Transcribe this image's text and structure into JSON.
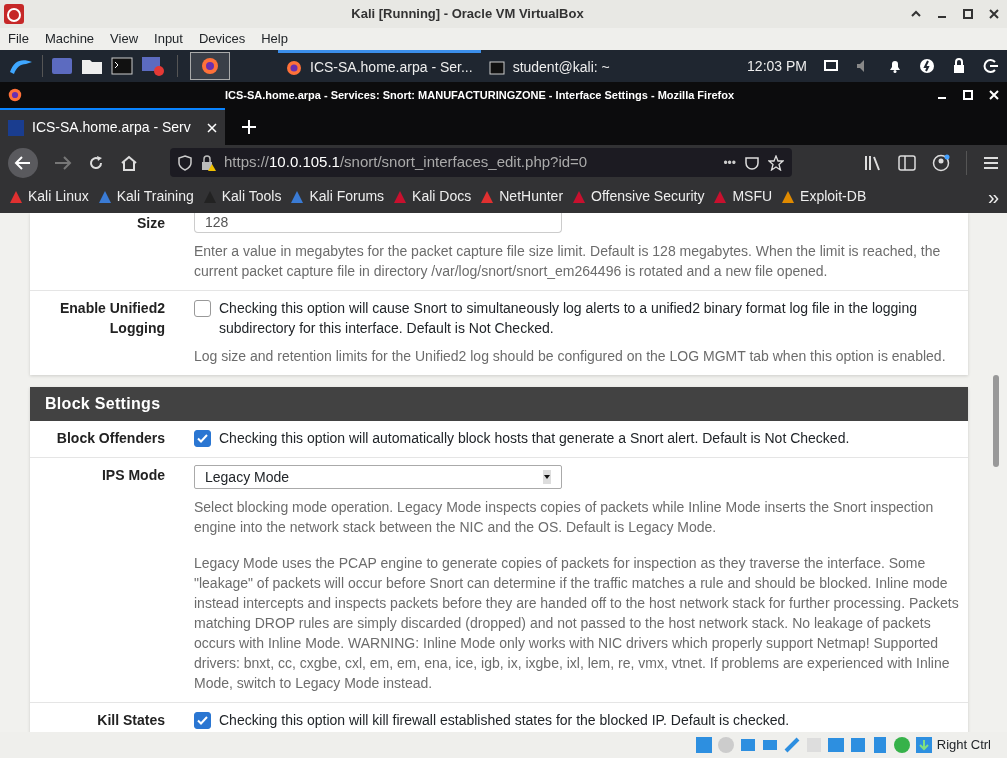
{
  "vbox": {
    "title": "Kali [Running] - Oracle VM VirtualBox",
    "menu": [
      "File",
      "Machine",
      "View",
      "Input",
      "Devices",
      "Help"
    ],
    "status_text": "Right Ctrl"
  },
  "taskbar": {
    "tasks": [
      {
        "label": "ICS-SA.home.arpa - Ser...",
        "kind": "firefox",
        "selected": true
      },
      {
        "label": "student@kali: ~",
        "kind": "terminal",
        "selected": false
      }
    ],
    "clock": "12:03 PM"
  },
  "firefox": {
    "title": "ICS-SA.home.arpa - Services: Snort: MANUFACTURINGZONE - Interface Settings - Mozilla Firefox",
    "tab": "ICS-SA.home.arpa - Serv",
    "url_prefix": "https://",
    "url_host": "10.0.105.1",
    "url_path": "/snort/snort_interfaces_edit.php?id=0",
    "more": "•••",
    "overflow": "»",
    "bookmarks": [
      {
        "label": "Kali Linux",
        "color": "#e03030"
      },
      {
        "label": "Kali Training",
        "color": "#3a7bd5"
      },
      {
        "label": "Kali Tools",
        "color": "#222222"
      },
      {
        "label": "Kali Forums",
        "color": "#3a7bd5"
      },
      {
        "label": "Kali Docs",
        "color": "#c8102e"
      },
      {
        "label": "NetHunter",
        "color": "#e03030"
      },
      {
        "label": "Offensive Security",
        "color": "#c8102e"
      },
      {
        "label": "MSFU",
        "color": "#c8102e"
      },
      {
        "label": "Exploit-DB",
        "color": "#e08a00"
      }
    ]
  },
  "page": {
    "top_rows": [
      {
        "kind": "input",
        "label": "Size",
        "value": "128",
        "help": "Enter a value in megabytes for the packet capture file size limit. Default is 128 megabytes. When the limit is reached, the current packet capture file in directory /var/log/snort/snort_em264496 is rotated and a new file opened."
      },
      {
        "kind": "checkbox",
        "label": "Enable Unified2 Logging",
        "checked": false,
        "text": "Checking this option will cause Snort to simultaneously log alerts to a unified2 binary format log file in the logging subdirectory for this interface. Default is Not Checked.",
        "help": "Log size and retention limits for the Unified2 log should be configured on the LOG MGMT tab when this option is enabled."
      }
    ],
    "section": "Block Settings",
    "rows": [
      {
        "kind": "checkbox",
        "label": "Block Offenders",
        "checked": true,
        "text": "Checking this option will automatically block hosts that generate a Snort alert. Default is Not Checked."
      },
      {
        "kind": "select",
        "label": "IPS Mode",
        "value": "Legacy Mode",
        "help": "Select blocking mode operation. Legacy Mode inspects copies of packets while Inline Mode inserts the Snort inspection engine into the network stack between the NIC and the OS. Default is Legacy Mode.",
        "help2": "Legacy Mode uses the PCAP engine to generate copies of packets for inspection as they traverse the interface. Some \"leakage\" of packets will occur before Snort can determine if the traffic matches a rule and should be blocked. Inline mode instead intercepts and inspects packets before they are handed off to the host network stack for further processing. Packets matching DROP rules are simply discarded (dropped) and not passed to the host network stack. No leakage of packets occurs with Inline Mode. WARNING: Inline Mode only works with NIC drivers which properly support Netmap! Supported drivers: bnxt, cc, cxgbe, cxl, em, em, ena, ice, igb, ix, ixgbe, ixl, lem, re, vmx, vtnet. If problems are experienced with Inline Mode, switch to Legacy Mode instead."
      },
      {
        "kind": "checkbox",
        "label": "Kill States",
        "checked": true,
        "text": "Checking this option will kill firewall established states for the blocked IP. Default is checked."
      }
    ]
  }
}
